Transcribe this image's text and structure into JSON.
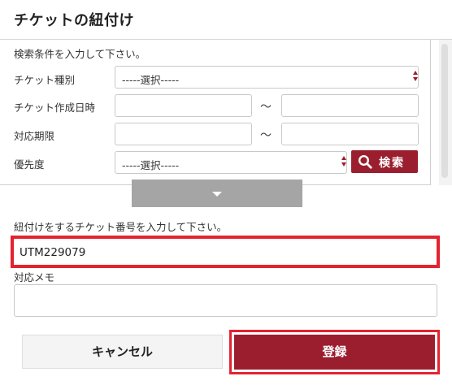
{
  "header": {
    "title": "チケットの紐付け"
  },
  "search": {
    "instruction": "検索条件を入力して下さい。",
    "ticket_type": {
      "label": "チケット種別",
      "selected": "-----選択-----"
    },
    "created_date": {
      "label": "チケット作成日時",
      "from": "",
      "to": "",
      "separator": "～"
    },
    "deadline": {
      "label": "対応期限",
      "from": "",
      "to": "",
      "separator": "～"
    },
    "priority": {
      "label": "優先度",
      "selected": "-----選択-----"
    },
    "search_button": "検索",
    "accent_color": "#9b1e2f"
  },
  "expand_toggle": {
    "icon": "caret-down-icon"
  },
  "ticket_number": {
    "instruction": "紐付けをするチケット番号を入力して下さい。",
    "value": "UTM229079",
    "highlight_color": "#e3232f"
  },
  "memo": {
    "label": "対応メモ",
    "value": ""
  },
  "actions": {
    "cancel_label": "キャンセル",
    "register_label": "登録"
  }
}
